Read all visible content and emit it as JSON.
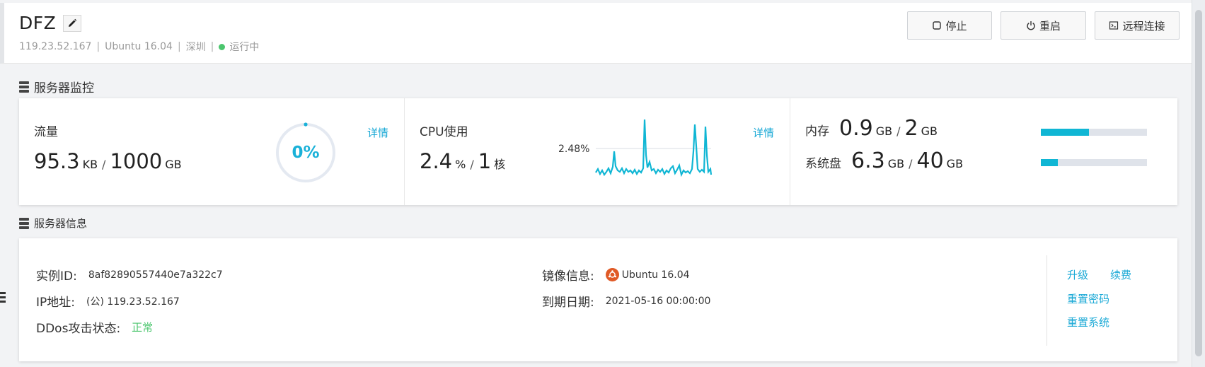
{
  "header": {
    "server_name": "DFZ",
    "ip": "119.23.52.167",
    "os": "Ubuntu 16.04",
    "region": "深圳",
    "status": "运行中",
    "status_color": "#4cc66e",
    "buttons": {
      "stop": "停止",
      "restart": "重启",
      "remote": "远程连接"
    }
  },
  "monitor": {
    "section_title": "服务器监控",
    "traffic": {
      "label": "流量",
      "used": "95.3",
      "used_unit": "KB",
      "total": "1000",
      "total_unit": "GB",
      "gauge_text": "0%",
      "gauge_percent": 0,
      "detail": "详情"
    },
    "cpu": {
      "label": "CPU使用",
      "used": "2.4",
      "used_unit": "%",
      "cores": "1",
      "cores_unit": "核",
      "reference_label": "2.48%",
      "detail": "详情"
    },
    "memory": {
      "label": "内存",
      "used": "0.9",
      "used_unit": "GB",
      "total": "2",
      "total_unit": "GB",
      "percent": 45
    },
    "disk": {
      "label": "系统盘",
      "used": "6.3",
      "used_unit": "GB",
      "total": "40",
      "total_unit": "GB",
      "percent": 16
    },
    "accent_color": "#10b6d4"
  },
  "info": {
    "section_title": "服务器信息",
    "instance_id_label": "实例ID:",
    "instance_id": "8af82890557440e7a322c7",
    "ip_label": "IP地址:",
    "ip_value": "(公) 119.23.52.167",
    "ddos_label": "DDos攻击状态:",
    "ddos_value": "正常",
    "image_label": "镜像信息:",
    "image_value": "Ubuntu 16.04",
    "expire_label": "到期日期:",
    "expire_value": "2021-05-16 00:00:00",
    "ops": {
      "upgrade": "升级",
      "renew": "续费",
      "reset_password": "重置密码",
      "reset_system": "重置系统"
    },
    "link_color": "#1aa9d6"
  },
  "icons": [
    "edit-icon",
    "stop-icon",
    "power-icon",
    "terminal-icon",
    "server-stack-icon",
    "ubuntu-icon"
  ]
}
